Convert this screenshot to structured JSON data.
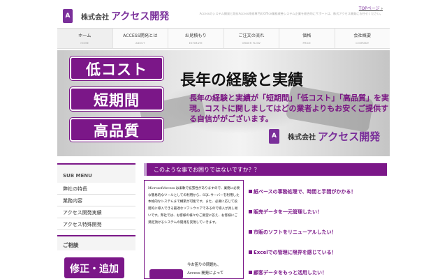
{
  "header": {
    "logo_mark": "A",
    "logo_kk": "株式会社",
    "logo_name": "アクセス開発",
    "top_link": "TOPページ",
    "tagline": "Accessのシステム開発と既存Access改修専門のOffice業務改善システム企業を総合的にサポートは、株式アクセス開発にお任せください。"
  },
  "nav": [
    {
      "jp": "ホーム",
      "en": "HOME"
    },
    {
      "jp": "ACCESS開発とは",
      "en": "ABOUT"
    },
    {
      "jp": "お見積もり",
      "en": "ESTIMATE"
    },
    {
      "jp": "ご注文の流れ",
      "en": "ORDER FLOW"
    },
    {
      "jp": "価格",
      "en": "PRICE"
    },
    {
      "jp": "会社概要",
      "en": "COMPANY"
    }
  ],
  "hero": {
    "badges": [
      "低コスト",
      "短期間",
      "高品質"
    ],
    "title": "長年の経験と実績",
    "body": "長年の経験と実績が「短期間」「低コスト」「高品質」を実現。コストに関しましてはどの業者よりもお安くご提供する自信ががございます。",
    "logo_mark": "A",
    "logo_kk": "株式会社",
    "logo_name": "アクセス開発"
  },
  "sidebar": {
    "title": "SUB MENU",
    "items": [
      "弊社の特長",
      "業務内容",
      "アクセス開発実績",
      "アクセス特殊開発"
    ],
    "guide_title": "ご相談",
    "guide_box": "修正・追加"
  },
  "main": {
    "heading": "このような事でお困りではないですか？？",
    "intro": "MicrosoftAccess は柔軟で拡張性がありますので、業務に必要な簡易的なツールとしての利用から、SQL サーバーを利用した本格的なシステムまで構築が可能です。また、必要に応じて段階的に導入できる最適なソフトウェアであるので導入が具し易いです。弊社では、お客様の様々なご要望に答え、お客様にご満足頂けるシステムの開発を実現していきます。",
    "intro_sub_1": "今お困りの問題も、",
    "intro_sub_2": "Access 開発によって",
    "issues": [
      "紙ベースの事務処理で、時間と手間がかかる！",
      "販売データを一元管理したい！",
      "市販のソフトをリニューアルしたい！",
      "Excelでの管理に限界を感じている！",
      "顧客データをもっと活用したい！"
    ]
  }
}
